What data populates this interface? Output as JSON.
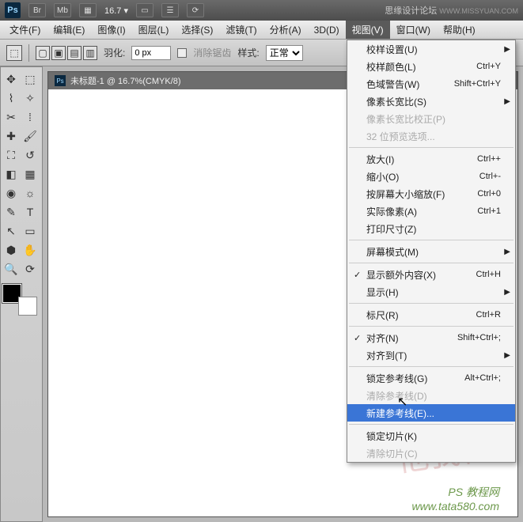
{
  "titlebar": {
    "appIcon": "Ps",
    "controls": [
      "Br",
      "Mb",
      "▦"
    ],
    "zoom": "16.7",
    "watermark": "思缘设计论坛",
    "watermarkUrl": "WWW.MISSYUAN.COM"
  },
  "menubar": {
    "items": [
      "文件(F)",
      "编辑(E)",
      "图像(I)",
      "图层(L)",
      "选择(S)",
      "滤镜(T)",
      "分析(A)",
      "3D(D)",
      "视图(V)",
      "窗口(W)",
      "帮助(H)"
    ],
    "activeIndex": 8
  },
  "optionsbar": {
    "featherLabel": "羽化:",
    "featherValue": "0 px",
    "antialias": "消除锯齿",
    "styleLabel": "样式:",
    "styleValue": "正常"
  },
  "document": {
    "tabTitle": "未标题-1 @ 16.7%(CMYK/8)"
  },
  "dropdown": {
    "groups": [
      [
        {
          "label": "校样设置(U)",
          "submenu": true
        },
        {
          "label": "校样颜色(L)",
          "shortcut": "Ctrl+Y"
        },
        {
          "label": "色域警告(W)",
          "shortcut": "Shift+Ctrl+Y"
        },
        {
          "label": "像素长宽比(S)",
          "submenu": true
        },
        {
          "label": "像素长宽比校正(P)",
          "disabled": true
        },
        {
          "label": "32 位预览选项...",
          "disabled": true
        }
      ],
      [
        {
          "label": "放大(I)",
          "shortcut": "Ctrl++"
        },
        {
          "label": "缩小(O)",
          "shortcut": "Ctrl+-"
        },
        {
          "label": "按屏幕大小缩放(F)",
          "shortcut": "Ctrl+0"
        },
        {
          "label": "实际像素(A)",
          "shortcut": "Ctrl+1"
        },
        {
          "label": "打印尺寸(Z)"
        }
      ],
      [
        {
          "label": "屏幕模式(M)",
          "submenu": true
        }
      ],
      [
        {
          "label": "显示额外内容(X)",
          "shortcut": "Ctrl+H",
          "checked": true
        },
        {
          "label": "显示(H)",
          "submenu": true
        }
      ],
      [
        {
          "label": "标尺(R)",
          "shortcut": "Ctrl+R"
        }
      ],
      [
        {
          "label": "对齐(N)",
          "shortcut": "Shift+Ctrl+;",
          "checked": true
        },
        {
          "label": "对齐到(T)",
          "submenu": true
        }
      ],
      [
        {
          "label": "锁定参考线(G)",
          "shortcut": "Alt+Ctrl+;"
        },
        {
          "label": "清除参考线(D)",
          "disabled": true
        },
        {
          "label": "新建参考线(E)...",
          "highlight": true
        }
      ],
      [
        {
          "label": "锁定切片(K)"
        },
        {
          "label": "清除切片(C)",
          "disabled": true
        }
      ]
    ]
  },
  "footerWatermark": {
    "line1": "PS 教程网",
    "line2": "www.tata580.com"
  },
  "bgWatermark": "他我样"
}
